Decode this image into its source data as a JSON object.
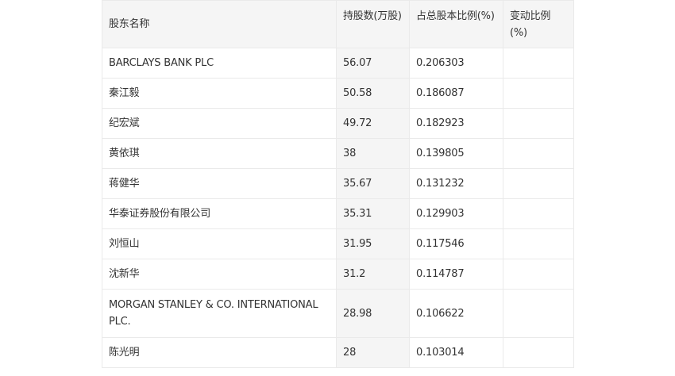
{
  "table": {
    "headers": [
      "股东名称",
      "持股数(万股)",
      "占总股本比例(%)",
      "变动比例(%)"
    ],
    "rows": [
      {
        "name": "BARCLAYS BANK PLC",
        "shares": "56.07",
        "ratio": "0.206303",
        "change": ""
      },
      {
        "name": "秦江毅",
        "shares": "50.58",
        "ratio": "0.186087",
        "change": ""
      },
      {
        "name": "纪宏斌",
        "shares": "49.72",
        "ratio": "0.182923",
        "change": ""
      },
      {
        "name": "黄依琪",
        "shares": "38",
        "ratio": "0.139805",
        "change": ""
      },
      {
        "name": "蒋健华",
        "shares": "35.67",
        "ratio": "0.131232",
        "change": ""
      },
      {
        "name": "华泰证券股份有限公司",
        "shares": "35.31",
        "ratio": "0.129903",
        "change": ""
      },
      {
        "name": "刘恒山",
        "shares": "31.95",
        "ratio": "0.117546",
        "change": ""
      },
      {
        "name": "沈新华",
        "shares": "31.2",
        "ratio": "0.114787",
        "change": ""
      },
      {
        "name": "MORGAN STANLEY & CO. INTERNATIONAL PLC.",
        "shares": "28.98",
        "ratio": "0.106622",
        "change": ""
      },
      {
        "name": "陈光明",
        "shares": "28",
        "ratio": "0.103014",
        "change": ""
      }
    ]
  }
}
